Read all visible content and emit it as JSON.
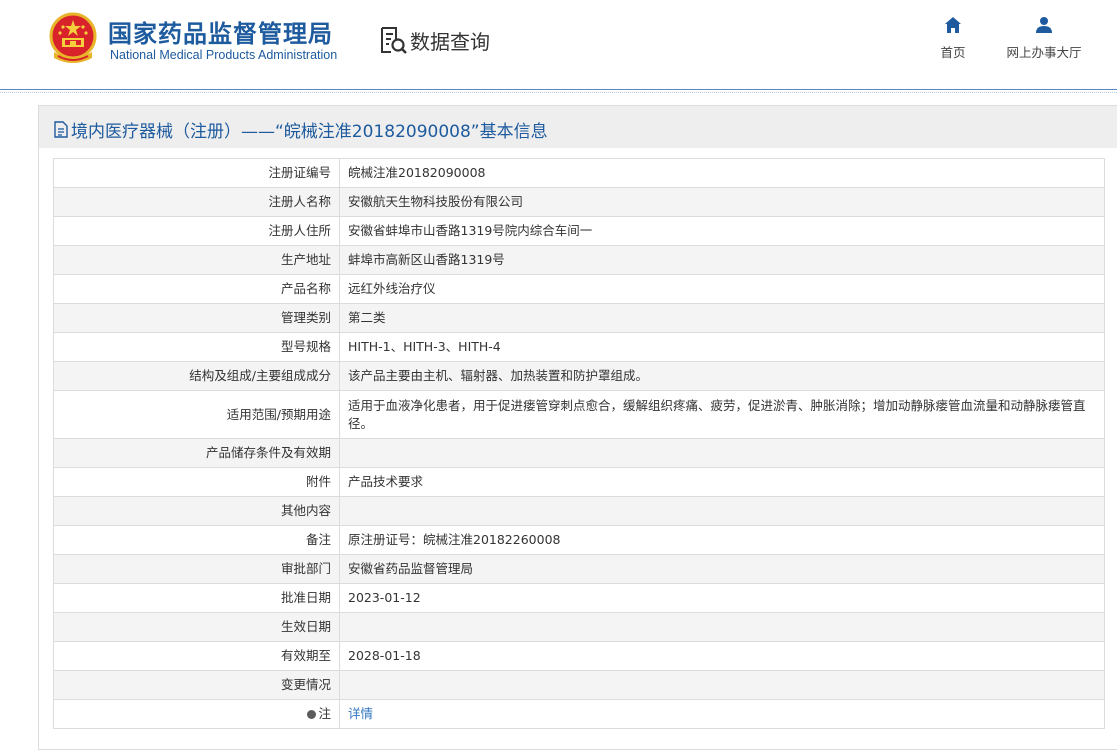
{
  "header": {
    "agency_cn": "国家药品监督管理局",
    "agency_en": "National Medical Products Administration",
    "query_label": "数据查询",
    "nav": [
      {
        "label": "首页",
        "icon": "home-icon"
      },
      {
        "label": "网上办事大厅",
        "icon": "user-icon"
      }
    ]
  },
  "panel": {
    "title": "境内医疗器械（注册）——“皖械注准20182090008”基本信息"
  },
  "table": {
    "rows": [
      {
        "label": "注册证编号",
        "value": "皖械注准20182090008"
      },
      {
        "label": "注册人名称",
        "value": "安徽航天生物科技股份有限公司"
      },
      {
        "label": "注册人住所",
        "value": "安徽省蚌埠市山香路1319号院内综合车间一"
      },
      {
        "label": "生产地址",
        "value": "蚌埠市高新区山香路1319号"
      },
      {
        "label": "产品名称",
        "value": "远红外线治疗仪"
      },
      {
        "label": "管理类别",
        "value": "第二类"
      },
      {
        "label": "型号规格",
        "value": "HITH-1、HITH-3、HITH-4"
      },
      {
        "label": "结构及组成/主要组成成分",
        "value": "该产品主要由主机、辐射器、加热装置和防护罩组成。"
      },
      {
        "label": "适用范围/预期用途",
        "value": "适用于血液净化患者，用于促进瘘管穿刺点愈合，缓解组织疼痛、疲劳，促进淤青、肿胀消除；增加动静脉瘘管血流量和动静脉瘘管直径。"
      },
      {
        "label": "产品储存条件及有效期",
        "value": ""
      },
      {
        "label": "附件",
        "value": "产品技术要求"
      },
      {
        "label": "其他内容",
        "value": ""
      },
      {
        "label": "备注",
        "value": "原注册证号：皖械注准20182260008"
      },
      {
        "label": "审批部门",
        "value": "安徽省药品监督管理局"
      },
      {
        "label": "批准日期",
        "value": "2023-01-12"
      },
      {
        "label": "生效日期",
        "value": ""
      },
      {
        "label": "有效期至",
        "value": "2028-01-18"
      },
      {
        "label": "变更情况",
        "value": ""
      }
    ],
    "note_row": {
      "label": "注",
      "link_text": "详情"
    }
  },
  "colors": {
    "brand_blue": "#1d5a9e",
    "link_blue": "#2f74c0",
    "title_bar_gray": "#eeeeee",
    "alt_row_gray": "#f4f4f4"
  }
}
